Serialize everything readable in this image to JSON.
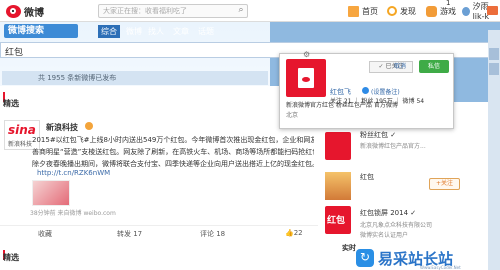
{
  "topbar": {
    "logo_text": "微博",
    "search_placeholder": "大家正在搜：收看福利吃了",
    "nav": [
      "首页",
      "发现",
      "游戏",
      "汐雨lik-k"
    ],
    "msg_count": "1"
  },
  "header": {
    "brand": "微博搜索",
    "tabs": [
      "综合",
      "微博",
      "找人",
      "文章",
      "话题"
    ],
    "query": "红包",
    "result_tip": "共 1955 条新微博已发布"
  },
  "feed": {
    "section_title": "精选",
    "author": "新浪科技",
    "sina_logo_top": "sina",
    "sina_logo_bottom": "新浪科技",
    "lines": [
      "2015#以红包飞#上线8小时内送出549万个红包。今年微博首次推出现金红包，企业和网友都可以给",
      "善商明星“营造”支棱送红包。网友除了刷新，在高铁火车、机场、商场等场所都能扫码抢红包。",
      "除夕夜春晚播出期间，微博将联合支付宝、四季快递等企业向用户送出搭近上亿的现金红包。"
    ],
    "short_link": "http://t.cn/RZK6nWM",
    "meta": "38分钟前 来自微博 weibo.com",
    "actions": [
      "收藏",
      "转发 17",
      "评论 18",
      "22"
    ],
    "section2_title": "精选"
  },
  "popup": {
    "name": "红包飞",
    "edit": "(设置备注)",
    "stats": "关注 21 ｜ 粉丝 195万 ｜ 微博 54",
    "intro": "新浪微博官方红包 粉丝红包产品 官方微博",
    "location": "北京",
    "followed": "✓ 已关注",
    "cancel": "取消",
    "dm": "私信"
  },
  "rightcol": {
    "items": [
      {
        "name": "粉丝红包 ✓",
        "desc": "新浪微博红包产品官方..."
      },
      {
        "name": "红包"
      },
      {
        "name": "红包锁屏 2014 ✓",
        "desc": "北京凡象点众科技有限公司",
        "sub": "微博实名认证用户"
      }
    ],
    "thumb3_text": "红包",
    "follow_btn": "+关注",
    "real_time": "实时"
  },
  "watermark": {
    "main": "易采站长站",
    "url": "Www.EasyCoder.Net"
  }
}
